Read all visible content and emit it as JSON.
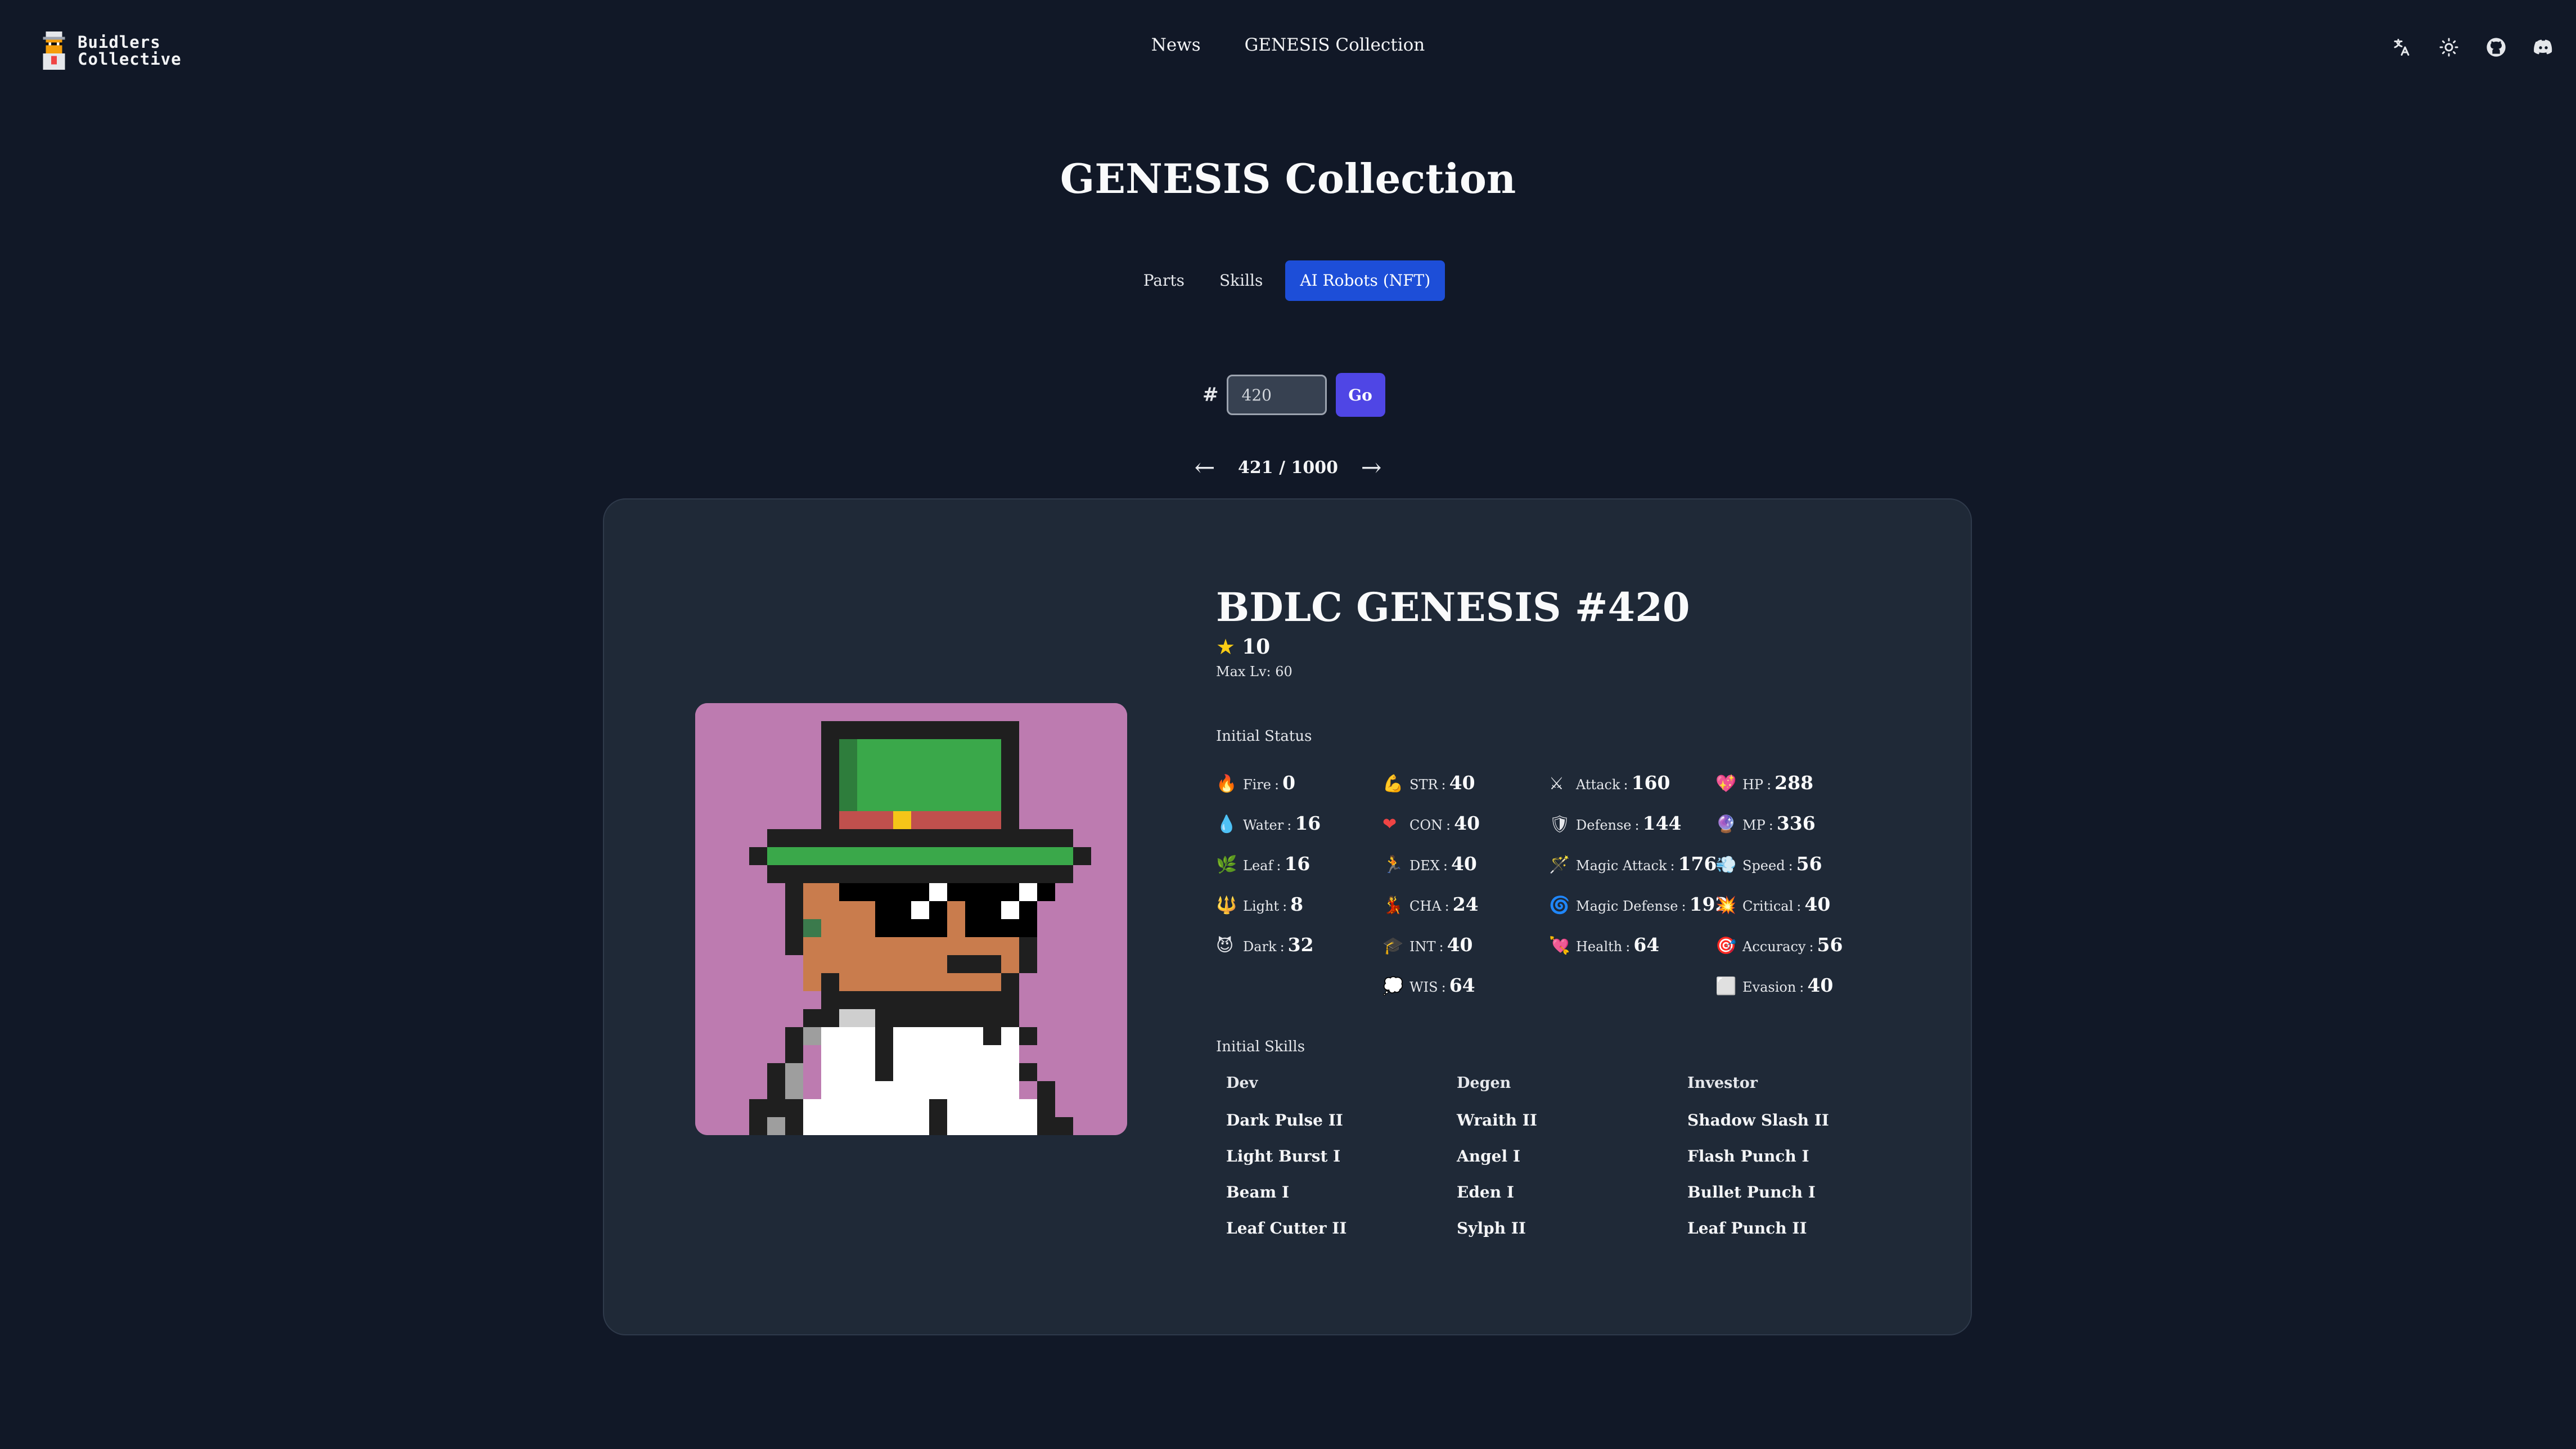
{
  "header": {
    "logo_line1": "Buidlers",
    "logo_line2": "Collective",
    "nav": [
      "News",
      "GENESIS Collection"
    ],
    "icons": [
      "translate-icon",
      "theme-icon",
      "github-icon",
      "discord-icon"
    ]
  },
  "page": {
    "title": "GENESIS Collection",
    "tabs": [
      "Parts",
      "Skills",
      "AI Robots (NFT)"
    ],
    "active_tab": "AI Robots (NFT)"
  },
  "search": {
    "hash": "#",
    "value": "420",
    "go_label": "Go"
  },
  "pager": {
    "count": "421 / 1000"
  },
  "nft": {
    "title": "BDLC GENESIS #420",
    "rarity": "10",
    "max_level": "Max Lv: 60",
    "status_label": "Initial Status",
    "skills_label": "Initial Skills",
    "stats": [
      [
        {
          "icon": "🔥",
          "name": "Fire",
          "value": "0"
        },
        {
          "icon": "💧",
          "name": "Water",
          "value": "16"
        },
        {
          "icon": "🌿",
          "name": "Leaf",
          "value": "16"
        },
        {
          "icon": "🔱",
          "name": "Light",
          "value": "8"
        },
        {
          "icon": "😈",
          "name": "Dark",
          "value": "32"
        }
      ],
      [
        {
          "icon": "💪",
          "name": "STR",
          "value": "40"
        },
        {
          "icon": "❤",
          "name": "CON",
          "value": "40"
        },
        {
          "icon": "🏃",
          "name": "DEX",
          "value": "40"
        },
        {
          "icon": "💃",
          "name": "CHA",
          "value": "24"
        },
        {
          "icon": "🎓",
          "name": "INT",
          "value": "40"
        },
        {
          "icon": "💭",
          "name": "WIS",
          "value": "64"
        }
      ],
      [
        {
          "icon": "⚔",
          "name": "Attack",
          "value": "160"
        },
        {
          "icon": "🛡",
          "name": "Defense",
          "value": "144"
        },
        {
          "icon": "🪄",
          "name": "Magic Attack",
          "value": "176"
        },
        {
          "icon": "🌀",
          "name": "Magic Defense",
          "value": "192"
        },
        {
          "icon": "💘",
          "name": "Health",
          "value": "64"
        }
      ],
      [
        {
          "icon": "💖",
          "name": "HP",
          "value": "288"
        },
        {
          "icon": "🔮",
          "name": "MP",
          "value": "336"
        },
        {
          "icon": "💨",
          "name": "Speed",
          "value": "56"
        },
        {
          "icon": "💥",
          "name": "Critical",
          "value": "40"
        },
        {
          "icon": "🎯",
          "name": "Accuracy",
          "value": "56"
        },
        {
          "icon": "⬜",
          "name": "Evasion",
          "value": "40"
        }
      ]
    ],
    "skills": [
      {
        "heading": "Dev",
        "items": [
          "Dark Pulse II",
          "Light Burst I",
          "Beam I",
          "Leaf Cutter II"
        ]
      },
      {
        "heading": "Degen",
        "items": [
          "Wraith II",
          "Angel I",
          "Eden I",
          "Sylph II"
        ]
      },
      {
        "heading": "Investor",
        "items": [
          "Shadow Slash II",
          "Flash Punch I",
          "Bullet Punch I",
          "Leaf Punch II"
        ]
      }
    ]
  },
  "colors": {
    "background": "#111827",
    "card": "#1f2937",
    "active_tab": "#1d4ed8",
    "go_button": "#4f46e5",
    "nft_background": "#bd7bb0"
  }
}
